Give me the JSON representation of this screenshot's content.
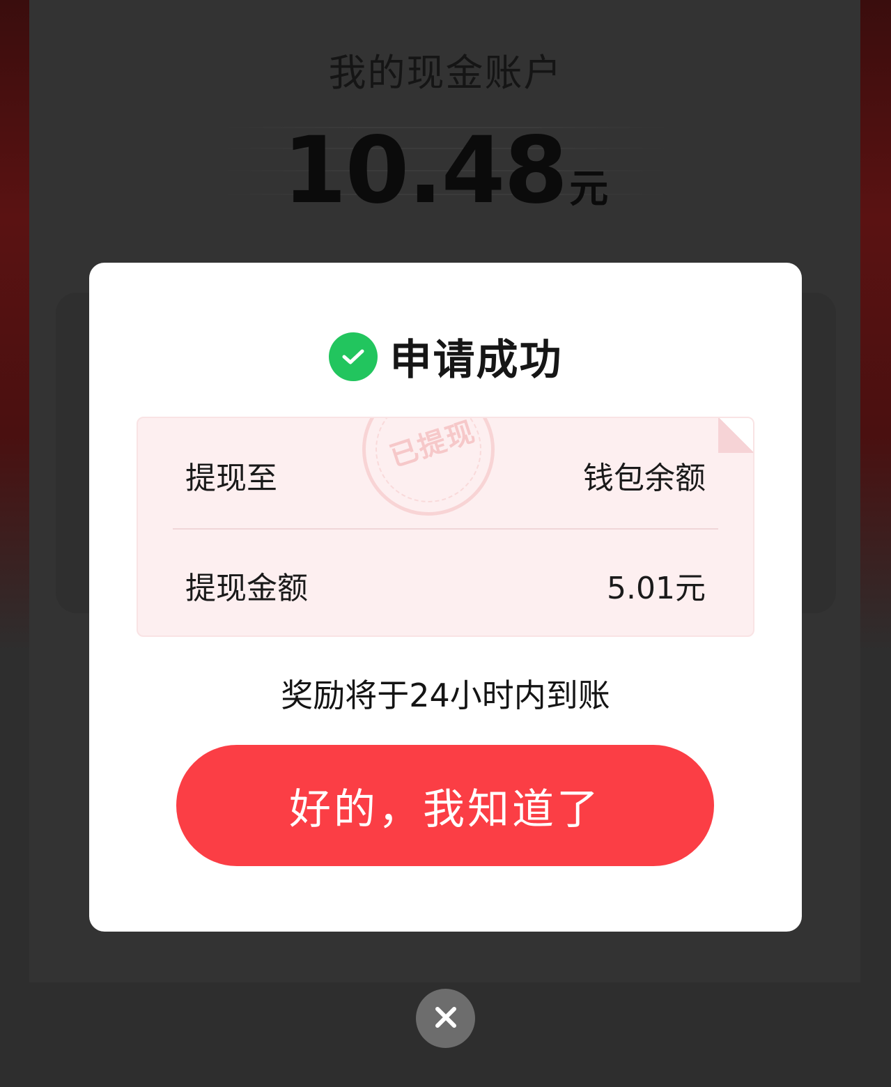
{
  "background": {
    "account_title": "我的现金账户",
    "balance_value": "10.48",
    "balance_unit": "元"
  },
  "modal": {
    "title": "申请成功",
    "title_icon": "check-circle-icon",
    "stamp_text": "已提现",
    "rows": [
      {
        "label": "提现至",
        "value": "钱包余额"
      },
      {
        "label": "提现金额",
        "value": "5.01元"
      }
    ],
    "notice": "奖励将于24小时内到账",
    "ok_button_label": "好的，我知道了"
  },
  "close_icon": "close-icon",
  "colors": {
    "accent_red": "#fb3e45",
    "success_green": "#22c55e",
    "receipt_bg": "#fdeff0",
    "overlay_bg": "#2e2e2e"
  }
}
